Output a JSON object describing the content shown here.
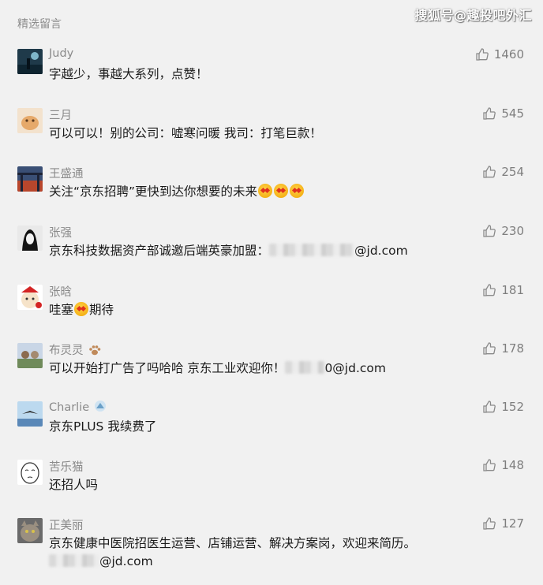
{
  "header": {
    "title": "精选留言",
    "watermark": "搜狐号@趣投吧外汇"
  },
  "icons": {
    "like": "thumbs-up-icon",
    "blur": "redacted-email-blur",
    "emoji_wow": "wow-face-emoji",
    "emoji_star_eyes": "star-struck-emoji",
    "name_paw": "paw-print-icon",
    "name_badge": "small-avatar-badge-icon"
  },
  "colors": {
    "background": "#f1f1f1",
    "name": "#8a8a8a",
    "text": "#1a1a1a",
    "like": "#7e7e7e"
  },
  "comments": [
    {
      "name": "Judy",
      "text": "字越少，事越大系列，点赞！",
      "likes": "1460"
    },
    {
      "name": "三月",
      "text": "可以可以！别的公司：嘘寒问暖 我司：打笔巨款！",
      "likes": "545"
    },
    {
      "name": "王盛通",
      "text": "关注“京东招聘”更快到达你想要的未来",
      "likes": "254"
    },
    {
      "name": "张强",
      "text": "京东科技数据资产部诚邀后端英豪加盟：",
      "text_suffix": "@jd.com",
      "likes": "230"
    },
    {
      "name": "张晗",
      "text": "哇塞",
      "text_suffix": "期待",
      "likes": "181"
    },
    {
      "name": "布灵灵",
      "text": "可以开始打广告了吗哈哈 京东工业欢迎你！",
      "text_suffix": "0@jd.com",
      "likes": "178"
    },
    {
      "name": "Charlie",
      "text": "京东PLUS 我续费了",
      "likes": "152"
    },
    {
      "name": "苦乐猫",
      "text": "还招人吗",
      "likes": "148"
    },
    {
      "name": "正美丽",
      "text": "京东健康中医院招医生运营、店铺运营、解决方案岗，欢迎来简历。",
      "text_line2_suffix": "@jd.com",
      "likes": "127"
    }
  ]
}
